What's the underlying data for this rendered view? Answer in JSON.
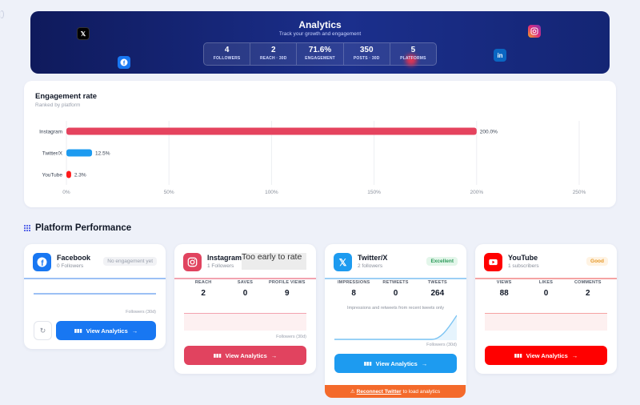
{
  "banner": {
    "title": "Analytics",
    "subtitle": "Track your growth and engagement",
    "stats": [
      {
        "value": "4",
        "label": "FOLLOWERS"
      },
      {
        "value": "2",
        "label": "REACH · 30D"
      },
      {
        "value": "71.6%",
        "label": "ENGAGEMENT"
      },
      {
        "value": "350",
        "label": "POSTS · 30D"
      },
      {
        "value": "5",
        "label": "PLATFORMS"
      }
    ],
    "icons": [
      "x-icon",
      "facebook-icon",
      "instagram-icon",
      "linkedin-icon"
    ]
  },
  "engagement": {
    "title": "Engagement rate",
    "subtitle": "Ranked by platform"
  },
  "chart_data": {
    "type": "bar",
    "orientation": "horizontal",
    "title": "Engagement rate",
    "subtitle": "Ranked by platform",
    "categories": [
      "Instagram",
      "Twitter/X",
      "YouTube"
    ],
    "values": [
      200.0,
      12.5,
      2.3
    ],
    "value_labels": [
      "200.0%",
      "12.5%",
      "2.3%"
    ],
    "colors": [
      "#e5435e",
      "#1d9bf0",
      "#ff1a1a"
    ],
    "xlim": [
      0,
      250
    ],
    "xticks": [
      "0%",
      "50%",
      "100%",
      "150%",
      "200%",
      "250%"
    ],
    "grid": true
  },
  "section": {
    "title": "Platform Performance"
  },
  "cards": {
    "facebook": {
      "name": "Facebook",
      "followers": "0 Followers",
      "badge": "No engagement yet",
      "spark_label": "Followers (30d)",
      "button": "View Analytics",
      "color": "#1877f2"
    },
    "instagram": {
      "name": "Instagram",
      "followers": "1 Followers",
      "overlay": "Too early to rate",
      "metrics": [
        {
          "label": "REACH",
          "value": "2"
        },
        {
          "label": "SAVES",
          "value": "0"
        },
        {
          "label": "PROFILE VIEWS",
          "value": "9"
        }
      ],
      "spark_label": "Followers (30d)",
      "button": "View Analytics",
      "color": "#e1435f"
    },
    "twitter": {
      "name": "Twitter/X",
      "followers": "2 followers",
      "badge": "Excellent",
      "metrics": [
        {
          "label": "IMPRESSIONS",
          "value": "8"
        },
        {
          "label": "RETWEETS",
          "value": "0"
        },
        {
          "label": "TWEETS",
          "value": "264"
        }
      ],
      "note": "Impressions and retweets from recent tweets only",
      "spark_label": "Followers (30d)",
      "button": "View Analytics",
      "color": "#1d9bf0",
      "warning_prefix": "⚠",
      "warning_link": "Reconnect Twitter",
      "warning_suffix": "to load analytics"
    },
    "youtube": {
      "name": "YouTube",
      "followers": "1 subscribers",
      "badge": "Good",
      "metrics": [
        {
          "label": "VIEWS",
          "value": "88"
        },
        {
          "label": "LIKES",
          "value": "0"
        },
        {
          "label": "COMMENTS",
          "value": "2"
        }
      ],
      "button": "View Analytics",
      "color": "#ff0000"
    }
  },
  "glyphs": {
    "arrow": "→",
    "bars": "▮▮▮",
    "refresh": "↻"
  }
}
